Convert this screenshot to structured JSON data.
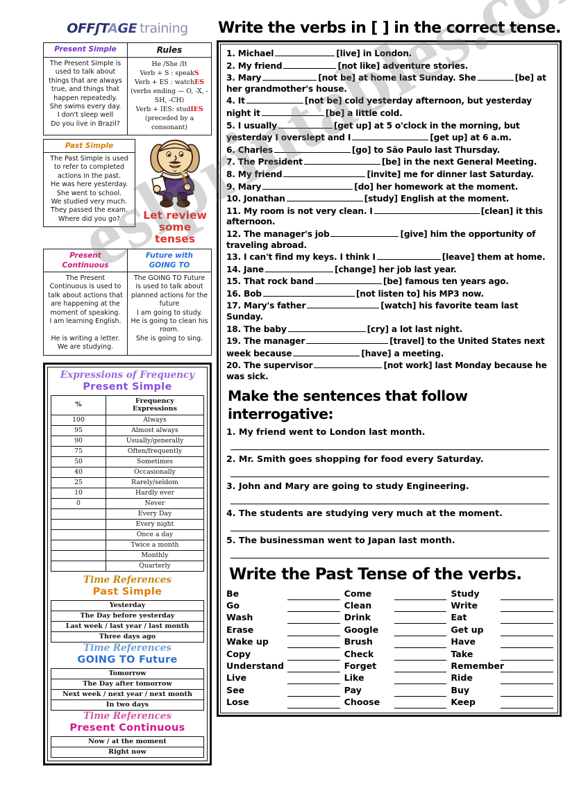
{
  "logo": {
    "part1": "OFFʃT",
    "part2": "A",
    "part3": "GE",
    "part4": "training"
  },
  "grammar": {
    "present_simple": {
      "title": "Present Simple",
      "body": "The Present Simple is used to talk about things that are always true, and things that happen repeatedly.\nShe swims every day.\nI don't sleep well\nDo you live in Brazil?"
    },
    "rules": {
      "title": "Rules",
      "line1": "He /She /It",
      "line2_a": "Verb + S : speak",
      "line2_b": "S",
      "line3_a": "Verb + ES : watch",
      "line3_b": "ES",
      "line4": "(verbs ending — O, -X, -SH, -CH)",
      "line5_a": "Verb + IES: stud",
      "line5_b": "IES",
      "line6": "(preceded by a consonant)"
    },
    "past_simple": {
      "title": "Past Simple",
      "body": "The Past Simple is used to refer to completed actions in the past.\nHe was here yesterday.\nShe went to school.\nWe studied very much.\nThey passed the exam.\nWhere did you go?"
    },
    "mascot_caption_line1": "Let review",
    "mascot_caption_line2": "some tenses",
    "present_continuous": {
      "title_line1": "Present",
      "title_line2": "Continuous",
      "body": "The Present Continuous is used to talk about actions that are happening at the moment of speaking.\nI am learning English.\n\nHe is writing a letter.\nWe are studying."
    },
    "future_going_to": {
      "title_line1": "Future with",
      "title_line2": "GOING TO",
      "body": "The GOING TO Future is used to talk about planned actions for the future\nI am going to study.\nHe is going to clean his room.\nShe is going to sing."
    }
  },
  "frequency": {
    "title_line1": "Expressions of Frequency",
    "title_line2": "Present Simple",
    "header_pct": "%",
    "header_expr_line1": "Frequency",
    "header_expr_line2": "Expressions",
    "rows": [
      {
        "pct": "100",
        "expr": "Always"
      },
      {
        "pct": "95",
        "expr": "Almost always"
      },
      {
        "pct": "90",
        "expr": "Usually/generally"
      },
      {
        "pct": "75",
        "expr": "Often/frequently"
      },
      {
        "pct": "50",
        "expr": "Sometimes"
      },
      {
        "pct": "40",
        "expr": "Occasionally"
      },
      {
        "pct": "25",
        "expr": "Rarely/seldom"
      },
      {
        "pct": "10",
        "expr": "Hardly ever"
      },
      {
        "pct": "0",
        "expr": "Never"
      },
      {
        "pct": "",
        "expr": "Every Day"
      },
      {
        "pct": "",
        "expr": "Every night"
      },
      {
        "pct": "",
        "expr": "Once a day"
      },
      {
        "pct": "",
        "expr": "Twice a month"
      },
      {
        "pct": "",
        "expr": "Monthly"
      },
      {
        "pct": "",
        "expr": "Quarterly"
      }
    ]
  },
  "time_refs": [
    {
      "title_line1": "Time References",
      "title_line2": "Past Simple",
      "color_script": "#c2860f",
      "color_block": "#e07b10",
      "rows": [
        "Yesterday",
        "The Day before yesterday",
        "Last week / last year / last month",
        "Three days ago"
      ]
    },
    {
      "title_line1": "Time References",
      "title_line2": "GOING TO Future",
      "color_script": "#6d9fd8",
      "color_block": "#2a6fd6",
      "rows": [
        "Tomorrow",
        "The Day after tomorrow",
        "Next week / next year / next month",
        "In two days"
      ]
    },
    {
      "title_line1": "Time References",
      "title_line2": "Present Continuous",
      "color_script": "#d456a8",
      "color_block": "#d8148c",
      "rows": [
        "Now / at the moment",
        "Right now"
      ]
    }
  ],
  "exercise1": {
    "heading": "Write the verbs in [  ] in the correct tense.",
    "items": [
      {
        "n": "1.",
        "pre": "Michael",
        "blank": 86,
        "post": "[live] in London."
      },
      {
        "n": "2.",
        "pre": "My friend",
        "blank": 76,
        "post": "[not like] adventure stories."
      },
      {
        "n": "3.",
        "pre": "Mary",
        "blank": 78,
        "post": "[not be] at home last Sunday. She",
        "blank2": 52,
        "post2": "[be] at her grandmother's house."
      },
      {
        "n": "4.",
        "pre": "It",
        "blank": 82,
        "post": "[not be] cold yesterday afternoon, but yesterday night it",
        "blank2": 90,
        "post2": "[be] a little cold."
      },
      {
        "n": "5.",
        "pre": "I usually",
        "blank": 78,
        "post": "[get up] at 5 o'clock in the morning, but yesterday I overslept and I",
        "blank2": 110,
        "post2": "[get up] at 6 a.m."
      },
      {
        "n": "6.",
        "pre": "Charles",
        "blank": 110,
        "post": "[go] to São Paulo last Thursday."
      },
      {
        "n": "7.",
        "pre": "The President",
        "blank": 110,
        "post": "[be] in the next General Meeting."
      },
      {
        "n": "8.",
        "pre": "My friend",
        "blank": 118,
        "post": "[invite] me for dinner last Saturday."
      },
      {
        "n": "9.",
        "pre": "Mary",
        "blank": 130,
        "post": "[do] her homework at the moment."
      },
      {
        "n": "10.",
        "pre": "Jonathan",
        "blank": 110,
        "post": "[study] English at the moment."
      },
      {
        "n": "11.",
        "pre": "My room is not very clean. I",
        "blank": 152,
        "post": "[clean] it this afternoon."
      },
      {
        "n": "12.",
        "pre": "The manager's job",
        "blank": 98,
        "post": "[give] him the opportunity of traveling abroad."
      },
      {
        "n": "13.",
        "pre": "I can't find my keys. I think I",
        "blank": 92,
        "post": "[leave] them at home."
      },
      {
        "n": "14.",
        "pre": "Jane",
        "blank": 98,
        "post": "[change] her job last year."
      },
      {
        "n": "15.",
        "pre": "That rock band",
        "blank": 96,
        "post": "[be] famous ten years ago."
      },
      {
        "n": "16.",
        "pre": "Bob",
        "blank": 132,
        "post": "[not listen to] his MP3 now."
      },
      {
        "n": "17.",
        "pre": "Mary's father",
        "blank": 104,
        "post": "[watch] his favorite team last Sunday."
      },
      {
        "n": "18.",
        "pre": "The baby",
        "blank": 112,
        "post": "[cry] a lot last night."
      },
      {
        "n": "19.",
        "pre": "The manager",
        "blank": 118,
        "post": "[travel] to the United States next week because",
        "blank2": 96,
        "post2": "[have] a meeting."
      },
      {
        "n": "20.",
        "pre": "The supervisor",
        "blank": 98,
        "post": "[not work] last Monday because he was sick."
      }
    ]
  },
  "exercise2": {
    "heading": "Make the sentences that follow interrogative:",
    "items": [
      "1. My friend went to London last month.",
      "2. Mr. Smith goes shopping for food every Saturday.",
      "3. John and Mary are going to study Engineering.",
      "4. The students are studying very much at the moment.",
      "5. The businessman went to Japan last month."
    ]
  },
  "exercise3": {
    "heading": "Write the Past Tense of the verbs.",
    "columns": [
      [
        "Be",
        "Go",
        "Wash",
        "Erase",
        "Wake up",
        "Copy",
        "Understand",
        "Live",
        "See",
        "Lose"
      ],
      [
        "Come",
        "Clean",
        "Drink",
        "Google",
        "Brush",
        "Check",
        "Forget",
        "Like",
        "Pay",
        "Choose"
      ],
      [
        "Study",
        "Write",
        "Eat",
        "Get up",
        "Have",
        "Take",
        "Remember",
        "Ride",
        "Buy",
        "Keep"
      ]
    ]
  },
  "watermark": {
    "text": "eslprintables.com"
  },
  "colors": {
    "purple": "#7b2fd4",
    "violet": "#9b6ae0",
    "orange": "#e07b10",
    "blue": "#2a6fd6",
    "pink": "#d8148c",
    "red": "#e33030",
    "logo_navy": "#2b2f6e"
  }
}
